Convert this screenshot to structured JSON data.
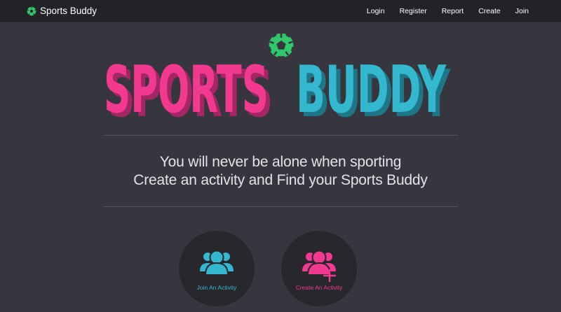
{
  "colors": {
    "background": "#37363e",
    "navbar": "#222228",
    "pink": "#f0398f",
    "pink_shadow": "#a42665",
    "cyan": "#33b8d0",
    "cyan_shadow": "#1f7689",
    "ball_green": "#2fc86b",
    "button_circle": "#27272c"
  },
  "navbar": {
    "brand_label": "Sports Buddy",
    "brand_icon": "soccer-ball-icon",
    "links": [
      "Login",
      "Register",
      "Report",
      "Create",
      "Join"
    ]
  },
  "hero": {
    "word1": "SPORTS",
    "word2": "BUDDY",
    "icon": "soccer-ball-icon"
  },
  "tagline": {
    "line1": "You will never be alone when sporting",
    "line2": "Create an activity and Find your Sports Buddy"
  },
  "actions": [
    {
      "label": "Join An Activity",
      "icon": "group-icon"
    },
    {
      "label": "Create An Activity",
      "icon": "group-add-icon"
    }
  ]
}
